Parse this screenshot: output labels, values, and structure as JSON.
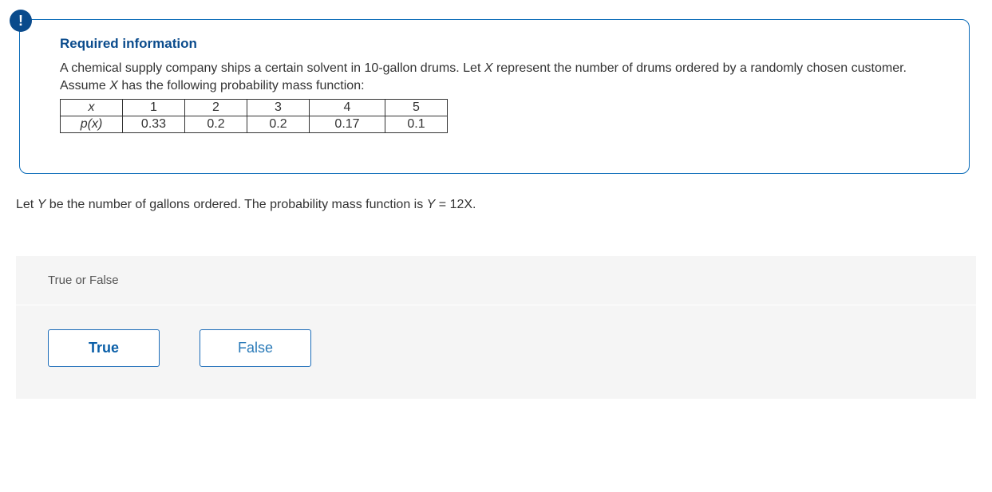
{
  "heading": "Required information",
  "problem": {
    "line1_pre": "A chemical supply company ships a certain solvent in 10-gallon drums. Let ",
    "line1_var": "X",
    "line1_post": " represent the number of drums ordered by a randomly chosen customer. Assume ",
    "line1_var2": "X",
    "line1_end": " has the following probability mass function:"
  },
  "table": {
    "row1_label": "x",
    "row1_values": [
      "1",
      "2",
      "3",
      "4",
      "5"
    ],
    "row2_label": "p(x)",
    "row2_values": [
      "0.33",
      "0.2",
      "0.2",
      "0.17",
      "0.1"
    ]
  },
  "question": {
    "pre": "Let ",
    "var1": "Y",
    "mid": " be the number of gallons ordered. The probability mass function is ",
    "var2": "Y",
    "post": " = 12X."
  },
  "answer_prompt": "True or False",
  "btn_true": "True",
  "btn_false": "False"
}
